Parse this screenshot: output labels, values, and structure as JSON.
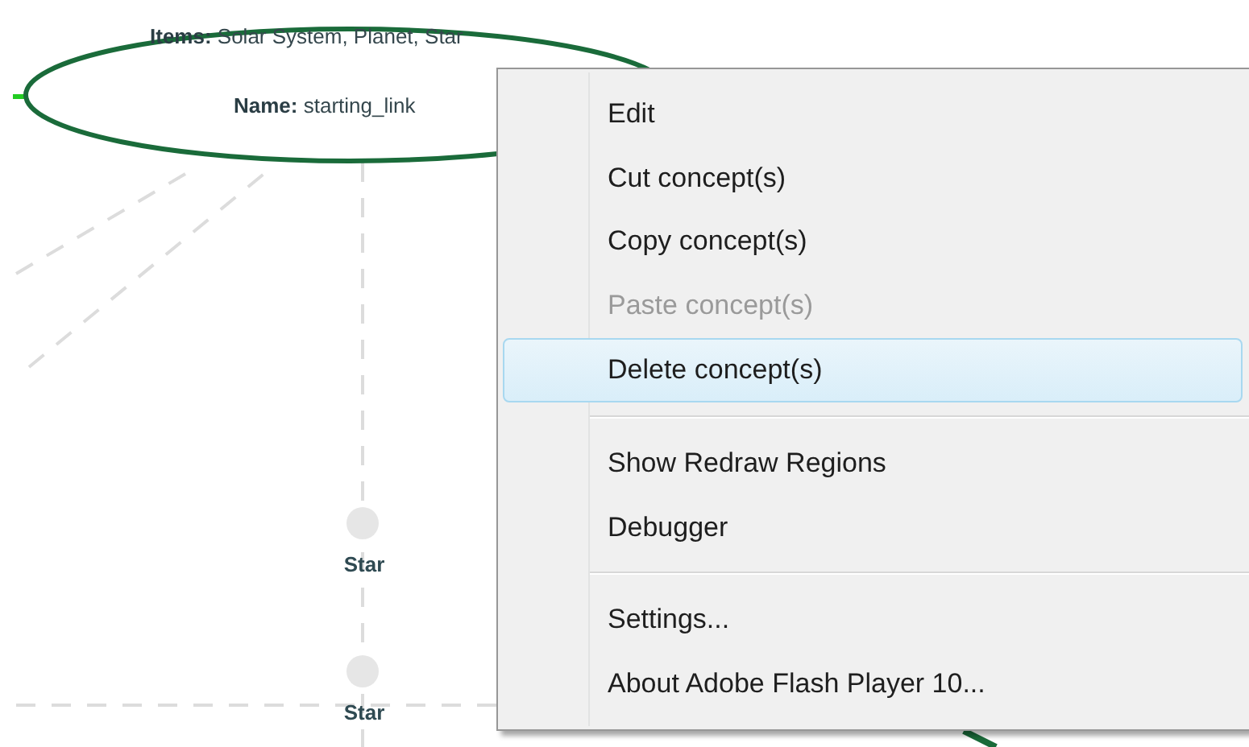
{
  "concept_node": {
    "items": "**Items:**  Solar System, Planet, Star",
    "name": "**Name:**  starting_link"
  },
  "nodes": [
    {
      "label": "Star"
    },
    {
      "label": "Star"
    }
  ],
  "context_menu": [
    {
      "kind": "item",
      "label": "Edit",
      "disabled": false,
      "selected": false
    },
    {
      "kind": "item",
      "label": "Cut concept(s)",
      "disabled": false,
      "selected": false
    },
    {
      "kind": "item",
      "label": "Copy concept(s)",
      "disabled": false,
      "selected": false
    },
    {
      "kind": "item",
      "label": "Paste concept(s)",
      "disabled": true,
      "selected": false
    },
    {
      "kind": "item",
      "label": "Delete concept(s)",
      "disabled": false,
      "selected": true
    },
    {
      "kind": "separator"
    },
    {
      "kind": "item",
      "label": "Show Redraw Regions",
      "disabled": false,
      "selected": false
    },
    {
      "kind": "item",
      "label": "Debugger",
      "disabled": false,
      "selected": false
    },
    {
      "kind": "separator"
    },
    {
      "kind": "item",
      "label": "Settings...",
      "disabled": false,
      "selected": false
    },
    {
      "kind": "item",
      "label": "About Adobe Flash Player 10...",
      "disabled": false,
      "selected": false
    }
  ]
}
